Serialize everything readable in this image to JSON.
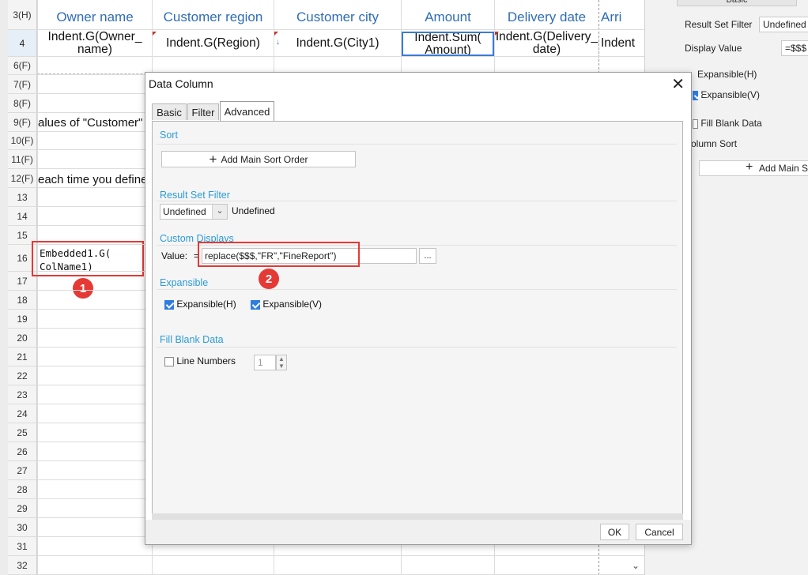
{
  "sheet": {
    "columns": [
      "Owner name",
      "Customer region",
      "Customer city",
      "Amount",
      "Delivery date",
      "Arri"
    ],
    "formulas": [
      "Indent.G(Owner_\nname)",
      "Indent.G(Region)",
      "Indent.G(City1)",
      "Indent.Sum(\nAmount)",
      "Indent.G(Delivery_\ndate)",
      "Indent"
    ],
    "row_labels": [
      "3(H)",
      "4",
      "6(F)",
      "7(F)",
      "8(F)",
      "9(F)",
      "10(F)",
      "11(F)",
      "12(F)",
      "13",
      "14",
      "15",
      "16",
      "17",
      "18",
      "19",
      "20",
      "21",
      "22",
      "23",
      "24",
      "25",
      "26",
      "27",
      "28",
      "29",
      "30",
      "31",
      "32"
    ],
    "partial_text_1": "alues of \"Customer\"",
    "partial_text_2": "each time you define",
    "embedded_cell": "Embedded1.G(\nColName1)"
  },
  "annotations": {
    "badge1": "1",
    "badge2": "2"
  },
  "right_panel": {
    "tab_label": "Basic",
    "result_set_filter_label": "Result Set Filter",
    "result_set_filter_value": "Undefined",
    "display_value_label": "Display Value",
    "display_value_value": "=$$$",
    "expansible_h": "Expansible(H)",
    "expansible_v": "Expansible(V)",
    "fill_blank": "Fill Blank Data",
    "column_sort": "olumn Sort",
    "add_main_sort": "Add Main S"
  },
  "dialog": {
    "title": "Data Column",
    "tabs": [
      "Basic",
      "Filter",
      "Advanced"
    ],
    "sort_title": "Sort",
    "add_sort_button": "Add Main Sort Order",
    "filter_title": "Result Set Filter",
    "filter_select_value": "Undefined",
    "filter_text": "Undefined",
    "custom_title": "Custom Displays",
    "value_label": "Value:",
    "value_eq": "=",
    "value_formula": "replace($$$,\"FR\",\"FineReport\")",
    "ellipsis": "...",
    "expansible_title": "Expansible",
    "exp_h": "Expansible(H)",
    "exp_v": "Expansible(V)",
    "fill_title": "Fill Blank Data",
    "line_numbers": "Line Numbers",
    "line_numbers_value": "1",
    "ok": "OK",
    "cancel": "Cancel"
  }
}
